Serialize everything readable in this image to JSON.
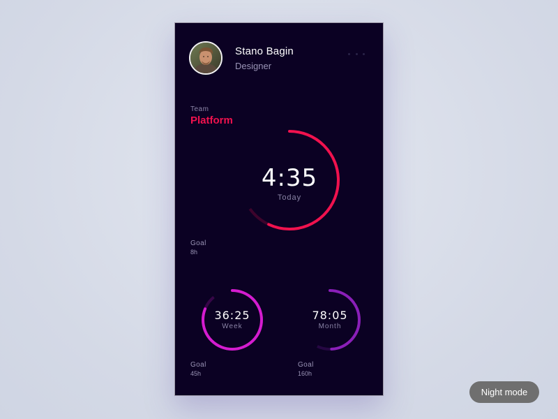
{
  "user": {
    "name": "Stano Bagin",
    "role": "Designer"
  },
  "team": {
    "label": "Team",
    "name": "Platform",
    "accent_color": "#f0124e"
  },
  "today": {
    "value": "4:35",
    "label": "Today",
    "goal_label": "Goal",
    "goal_value": "8h",
    "color": "#f0124e",
    "progress": 0.57
  },
  "week": {
    "value": "36:25",
    "label": "Week",
    "goal_label": "Goal",
    "goal_value": "45h",
    "color": "#d41ccf",
    "progress": 0.81
  },
  "month": {
    "value": "78:05",
    "label": "Month",
    "goal_label": "Goal",
    "goal_value": "160h",
    "color": "#8a1fb8",
    "progress": 0.49
  },
  "controls": {
    "night_mode_label": "Night mode"
  },
  "icons": {
    "more": "more-dots-icon",
    "avatar": "user-avatar"
  },
  "colors": {
    "background": "#0b0123",
    "page": "#d6dbe8"
  }
}
